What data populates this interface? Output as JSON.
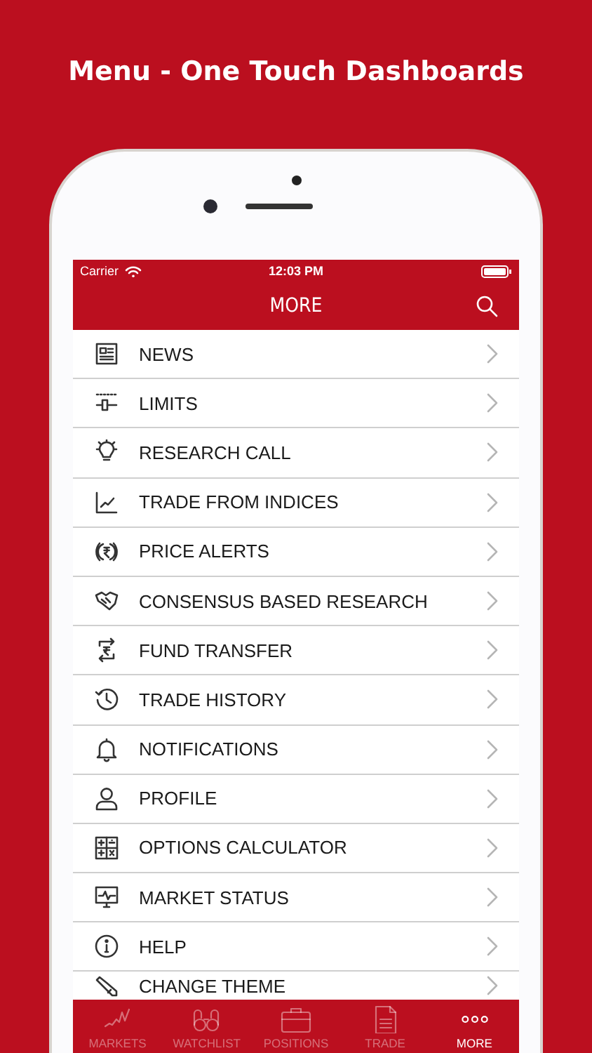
{
  "headline": "Menu - One Touch Dashboards",
  "status_bar": {
    "carrier": "Carrier",
    "time": "12:03 PM"
  },
  "nav_bar": {
    "title": "MORE"
  },
  "menu_items": [
    {
      "label": "NEWS"
    },
    {
      "label": "LIMITS"
    },
    {
      "label": "RESEARCH CALL"
    },
    {
      "label": "TRADE FROM INDICES"
    },
    {
      "label": "PRICE ALERTS"
    },
    {
      "label": "CONSENSUS BASED RESEARCH"
    },
    {
      "label": "FUND TRANSFER"
    },
    {
      "label": "TRADE HISTORY"
    },
    {
      "label": "NOTIFICATIONS"
    },
    {
      "label": "PROFILE"
    },
    {
      "label": "OPTIONS CALCULATOR"
    },
    {
      "label": "MARKET STATUS"
    },
    {
      "label": "HELP"
    },
    {
      "label": "CHANGE THEME"
    }
  ],
  "tab_bar": [
    {
      "label": "MARKETS",
      "selected": false
    },
    {
      "label": "WATCHLIST",
      "selected": false
    },
    {
      "label": "POSITIONS",
      "selected": false
    },
    {
      "label": "TRADE",
      "selected": false
    },
    {
      "label": "MORE",
      "selected": true
    }
  ]
}
